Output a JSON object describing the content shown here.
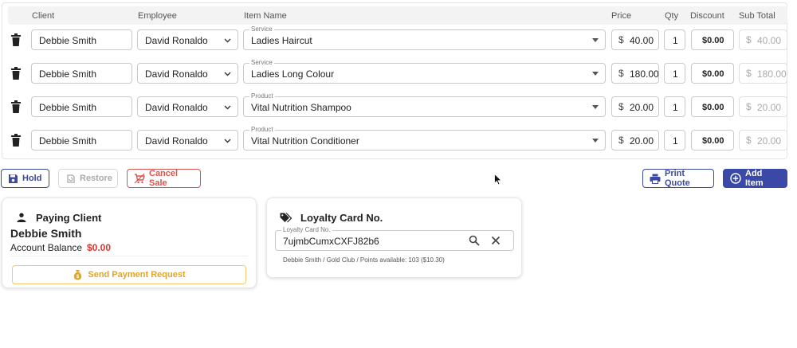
{
  "columns": {
    "client": "Client",
    "employee": "Employee",
    "item_name": "Item Name",
    "price": "Price",
    "qty": "Qty",
    "discount": "Discount",
    "sub_total": "Sub Total"
  },
  "rows": [
    {
      "client": "Debbie Smith",
      "employee": "David Ronaldo",
      "item_type": "Service",
      "item_name": "Ladies Haircut",
      "currency": "$",
      "price": "40.00",
      "qty": "1",
      "discount": "$0.00",
      "sub_total": "40.00"
    },
    {
      "client": "Debbie Smith",
      "employee": "David Ronaldo",
      "item_type": "Service",
      "item_name": "Ladies Long Colour",
      "currency": "$",
      "price": "180.00",
      "qty": "1",
      "discount": "$0.00",
      "sub_total": "180.00"
    },
    {
      "client": "Debbie Smith",
      "employee": "David Ronaldo",
      "item_type": "Product",
      "item_name": "Vital Nutrition Shampoo",
      "currency": "$",
      "price": "20.00",
      "qty": "1",
      "discount": "$0.00",
      "sub_total": "20.00"
    },
    {
      "client": "Debbie Smith",
      "employee": "David Ronaldo",
      "item_type": "Product",
      "item_name": "Vital Nutrition Conditioner",
      "currency": "$",
      "price": "20.00",
      "qty": "1",
      "discount": "$0.00",
      "sub_total": "20.00"
    }
  ],
  "actions": {
    "hold": "Hold",
    "restore": "Restore",
    "cancel_sale": "Cancel Sale",
    "print_quote": "Print Quote",
    "add_item": "Add Item"
  },
  "paying_client": {
    "title": "Paying Client",
    "name": "Debbie Smith",
    "balance_label": "Account Balance",
    "balance_value": "$0.00",
    "payment_request": "Send Payment Request"
  },
  "loyalty": {
    "title": "Loyalty Card No.",
    "field_label": "Loyalty Card No.",
    "value": "7ujmbCumxCXFJ82b6",
    "info": "Debbie Smith / Gold Club / Points available: 103 ($10.30)"
  },
  "colors": {
    "primary": "#3a48a8",
    "danger": "#d9362f",
    "warning": "#e0a526"
  },
  "icons": {
    "delete": "trash-icon",
    "hold": "save-icon",
    "restore": "restore-icon",
    "cancel": "cart-remove-icon",
    "print": "printer-icon",
    "add": "plus-circle-icon",
    "client": "person-icon",
    "loyalty": "tag-icon",
    "payment": "money-bag-icon",
    "search": "search-icon",
    "clear": "close-icon"
  }
}
